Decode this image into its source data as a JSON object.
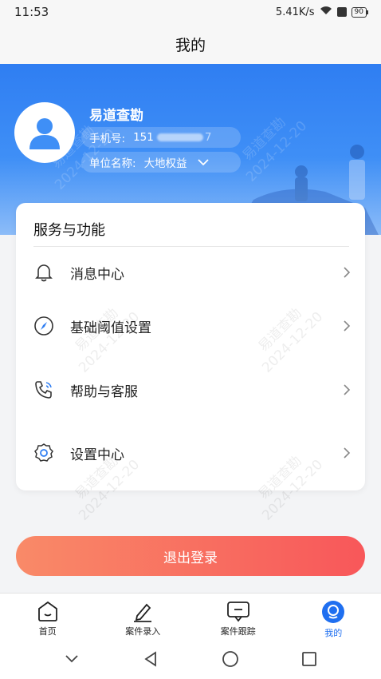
{
  "status_bar": {
    "time": "11:53",
    "speed": "5.41K/s",
    "battery": "90"
  },
  "page_title": "我的",
  "profile": {
    "name": "易道查勘",
    "phone_label": "手机号:",
    "phone_prefix": "151",
    "phone_suffix": "7",
    "unit_label": "单位名称:",
    "unit_value": "大地权益"
  },
  "services": {
    "title": "服务与功能",
    "items": [
      {
        "label": "消息中心",
        "icon": "bell-icon"
      },
      {
        "label": "基础阈值设置",
        "icon": "compass-icon"
      },
      {
        "label": "帮助与客服",
        "icon": "phone-call-icon"
      },
      {
        "label": "设置中心",
        "icon": "settings-gear-icon"
      }
    ]
  },
  "watermark": {
    "line1": "易道查勘",
    "line2": "2024-12-20"
  },
  "logout_label": "退出登录",
  "tabbar": {
    "items": [
      {
        "label": "首页",
        "icon": "home-icon"
      },
      {
        "label": "案件录入",
        "icon": "edit-icon"
      },
      {
        "label": "案件跟踪",
        "icon": "message-icon"
      },
      {
        "label": "我的",
        "icon": "profile-icon"
      }
    ],
    "active_index": 3
  },
  "colors": {
    "primary": "#2f7ef2",
    "logout_start": "#f98a68",
    "logout_end": "#f8575a",
    "active_tab": "#1f6ff0"
  }
}
